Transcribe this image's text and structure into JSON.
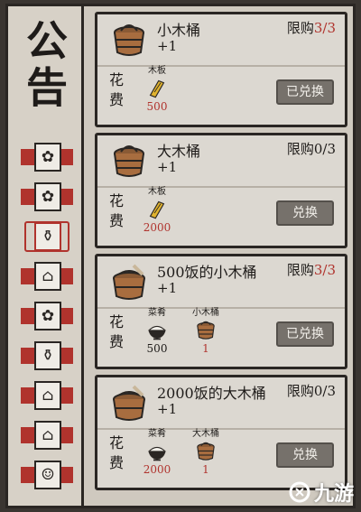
{
  "title": "公告",
  "tabs": [
    {
      "icon": "bush-icon",
      "active": false
    },
    {
      "icon": "bush-icon",
      "active": false
    },
    {
      "icon": "jar-icon",
      "active": true
    },
    {
      "icon": "house-icon",
      "active": false
    },
    {
      "icon": "bush-icon",
      "active": false
    },
    {
      "icon": "jar-icon",
      "active": false
    },
    {
      "icon": "house-icon",
      "active": false
    },
    {
      "icon": "house-icon",
      "active": false
    },
    {
      "icon": "chat-icon",
      "active": false
    }
  ],
  "cost_label": "花费",
  "items": [
    {
      "name": "小木桶",
      "qty": "+1",
      "limit_prefix": "限购",
      "limit_used": "3",
      "limit_total": "/3",
      "limit_red": true,
      "costs": [
        {
          "name": "木板",
          "value": "500",
          "icon": "plank-icon",
          "red": true
        }
      ],
      "button": "已兑换"
    },
    {
      "name": "大木桶",
      "qty": "+1",
      "limit_prefix": "限购",
      "limit_used": "0",
      "limit_total": "/3",
      "limit_red": false,
      "costs": [
        {
          "name": "木板",
          "value": "2000",
          "icon": "plank-icon",
          "red": true
        }
      ],
      "button": "兑换"
    },
    {
      "name": "500饭的小木桶",
      "qty": "+1",
      "limit_prefix": "限购",
      "limit_used": "3",
      "limit_total": "/3",
      "limit_red": true,
      "costs": [
        {
          "name": "菜肴",
          "value": "500",
          "icon": "rice-bowl-icon",
          "red": false
        },
        {
          "name": "小木桶",
          "value": "1",
          "icon": "bucket-icon",
          "red": true
        }
      ],
      "button": "已兑换"
    },
    {
      "name": "2000饭的大木桶",
      "qty": "+1",
      "limit_prefix": "限购",
      "limit_used": "0",
      "limit_total": "/3",
      "limit_red": false,
      "costs": [
        {
          "name": "菜肴",
          "value": "2000",
          "icon": "rice-bowl-icon",
          "red": true
        },
        {
          "name": "大木桶",
          "value": "1",
          "icon": "bucket-icon",
          "red": true
        }
      ],
      "button": "兑换"
    }
  ],
  "watermark": "九游"
}
